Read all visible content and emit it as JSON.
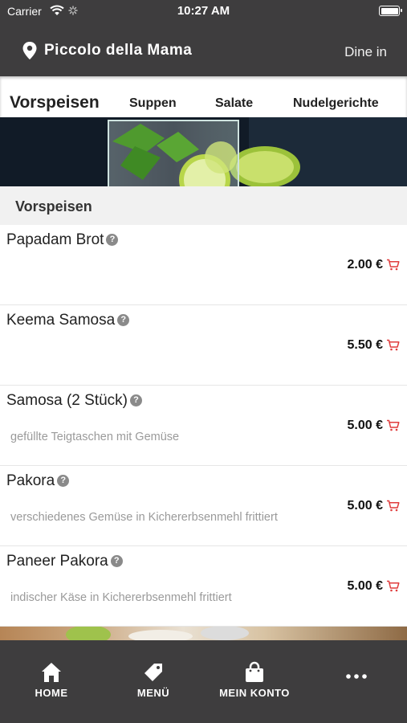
{
  "status": {
    "carrier": "Carrier",
    "time": "10:27 AM"
  },
  "header": {
    "restaurant": "Piccolo della Mama",
    "mode": "Dine in"
  },
  "tabs": [
    {
      "label": "Vorspeisen"
    },
    {
      "label": "Suppen"
    },
    {
      "label": "Salate"
    },
    {
      "label": "Nudelgerichte"
    }
  ],
  "section": {
    "title": "Vorspeisen"
  },
  "items": [
    {
      "name": "Papadam Brot",
      "desc": "",
      "price": "2.00 €"
    },
    {
      "name": "Keema Samosa",
      "desc": "",
      "price": "5.50 €"
    },
    {
      "name": "Samosa (2 Stück)",
      "desc": "gefüllte Teigtaschen mit Gemüse",
      "price": "5.00 €"
    },
    {
      "name": "Pakora",
      "desc": "verschiedenes Gemüse in Kichererbsenmehl frittiert",
      "price": "5.00 €"
    },
    {
      "name": "Paneer Pakora",
      "desc": "indischer Käse in Kichererbsenmehl frittiert",
      "price": "5.00 €"
    }
  ],
  "nav": [
    {
      "label": "HOME",
      "icon": "home-icon"
    },
    {
      "label": "MENÜ",
      "icon": "tag-icon"
    },
    {
      "label": "MEIN KONTO",
      "icon": "shopping-bag-icon"
    },
    {
      "label": "",
      "icon": "more-icon"
    }
  ],
  "colors": {
    "bar": "#3e3d3e",
    "cart_accent": "#e03c3c",
    "section_bg": "#f1f1f1"
  },
  "help_glyph": "?"
}
